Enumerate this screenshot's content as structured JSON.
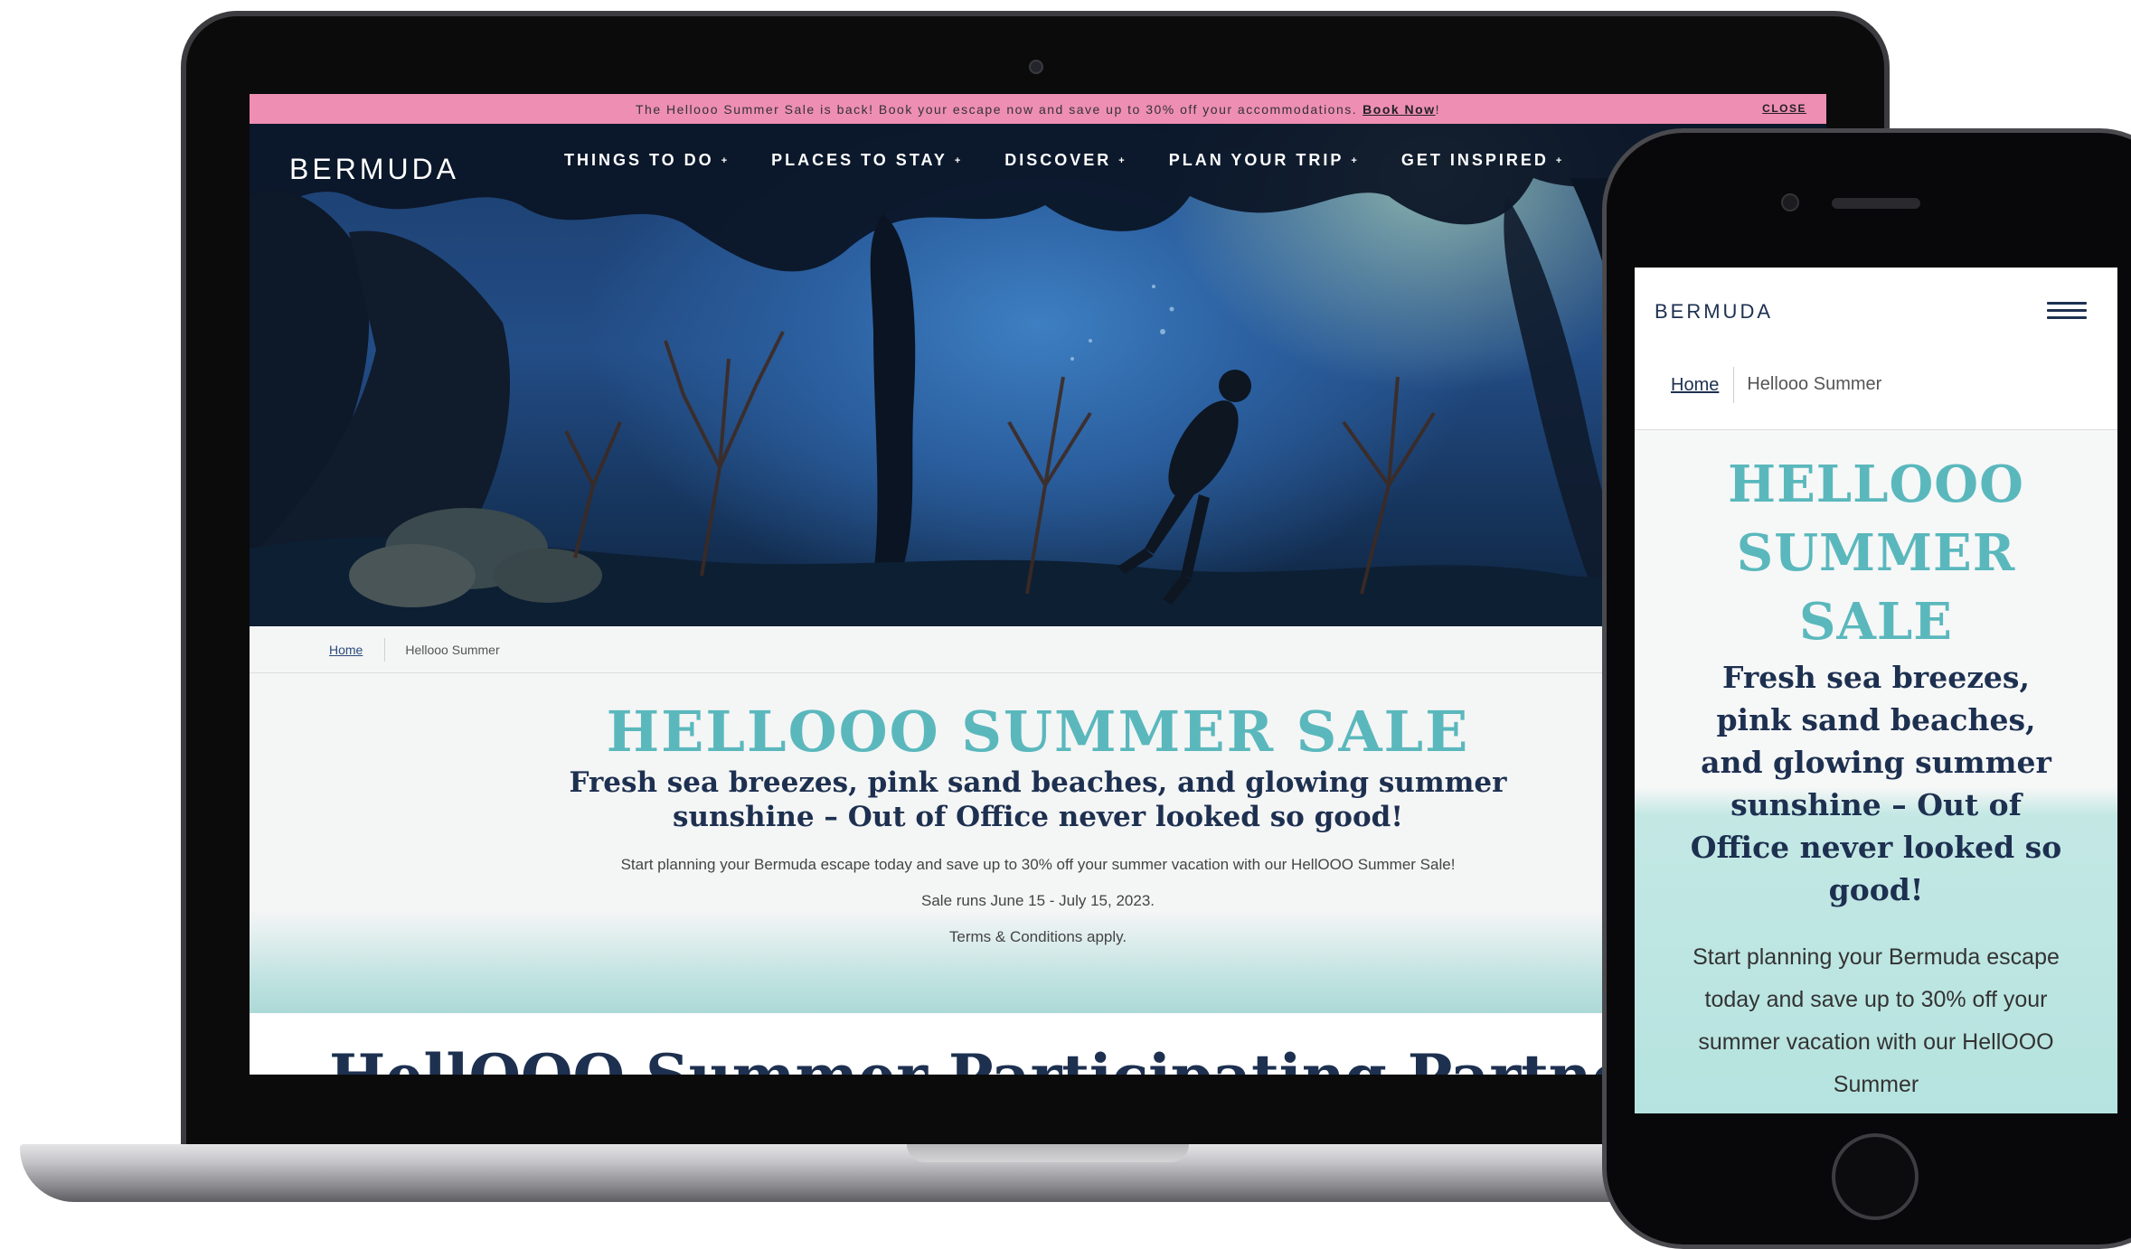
{
  "desktop": {
    "promo": {
      "text": "The Hellooo Summer Sale is back! Book your escape now and save up to 30% off your accommodations.",
      "link_label": "Book Now",
      "link_suffix": "!",
      "close_label": "CLOSE"
    },
    "logo": "BERMUDA",
    "nav": [
      {
        "label": "THINGS TO DO"
      },
      {
        "label": "PLACES TO STAY"
      },
      {
        "label": "DISCOVER"
      },
      {
        "label": "PLAN YOUR TRIP"
      },
      {
        "label": "GET INSPIRED"
      }
    ],
    "breadcrumb": {
      "home": "Home",
      "current": "Hellooo Summer"
    },
    "title": "HELLOOO SUMMER SALE",
    "subtitle": "Fresh sea breezes, pink sand beaches, and glowing summer sunshine – Out of Office never looked so good!",
    "body": "Start planning your Bermuda escape today and save up to 30% off your summer vacation with our HellOOO Summer Sale!",
    "sale_dates": "Sale runs June 15 - July 15, 2023.",
    "terms": "Terms & Conditions apply.",
    "next_heading": "HellOOO Summer Participating Partners"
  },
  "mobile": {
    "logo": "BERMUDA",
    "breadcrumb": {
      "home": "Home",
      "current": "Hellooo Summer"
    },
    "title": "HELLOOO SUMMER SALE",
    "subtitle": "Fresh sea breezes, pink sand beaches, and glowing summer sunshine – Out of Office never looked so good!",
    "body": "Start planning your Bermuda escape today and save up to 30% off your summer vacation with our HellOOO Summer"
  },
  "colors": {
    "promo_pink": "#ee8eb3",
    "title_teal": "#5ab8bd",
    "navy": "#1d3050"
  },
  "icons": {
    "nav_chevron": "chevron-down-icon",
    "mobile_menu": "hamburger-menu-icon"
  }
}
